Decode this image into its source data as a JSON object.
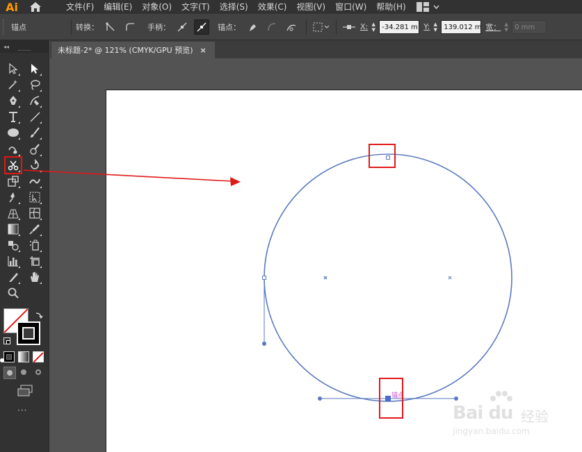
{
  "app": {
    "logo": "Ai",
    "menu": [
      "文件(F)",
      "编辑(E)",
      "对象(O)",
      "文字(T)",
      "选择(S)",
      "效果(C)",
      "视图(V)",
      "窗口(W)",
      "帮助(H)"
    ]
  },
  "control_bar": {
    "selection_label": "锚点",
    "convert_label": "转换：",
    "handle_label": "手柄：",
    "anchor_label": "锚点：",
    "x_label": "X:",
    "x_value": "-34.281 m",
    "y_label": "Y:",
    "y_value": "139.012 m",
    "w_label": "宽：",
    "w_value": "0 mm"
  },
  "tool_panel": {
    "collapse_glyph": "◂◂",
    "tools": [
      "selection-tool",
      "direct-selection-tool",
      "magic-wand-tool",
      "lasso-tool",
      "pen-tool",
      "curvature-tool",
      "type-tool",
      "line-segment-tool",
      "ellipse-tool",
      "paintbrush-tool",
      "shaper-tool",
      "blob-brush-tool",
      "scissors-tool",
      "rotate-tool",
      "scale-tool",
      "warp-tool",
      "puppet-warp-tool",
      "free-transform-tool",
      "perspective-grid-tool",
      "mesh-tool",
      "gradient-tool",
      "eyedropper-tool",
      "blend-tool",
      "symbol-sprayer-tool",
      "column-graph-tool",
      "artboard-tool",
      "slice-tool",
      "hand-tool",
      "zoom-tool"
    ],
    "active_tool": "scissors-tool",
    "more_glyph": "···"
  },
  "document": {
    "tab_title": "未标题-2* @ 121% (CMYK/GPU 预览)",
    "close_glyph": "×"
  },
  "canvas": {
    "anchor_hint": "锚点",
    "stroke_color": "#5a79c0",
    "annotation_color": "#e01818"
  },
  "watermark": {
    "logo": "Bai du",
    "brand": "经验",
    "url": "jingyan.baidu.com"
  }
}
